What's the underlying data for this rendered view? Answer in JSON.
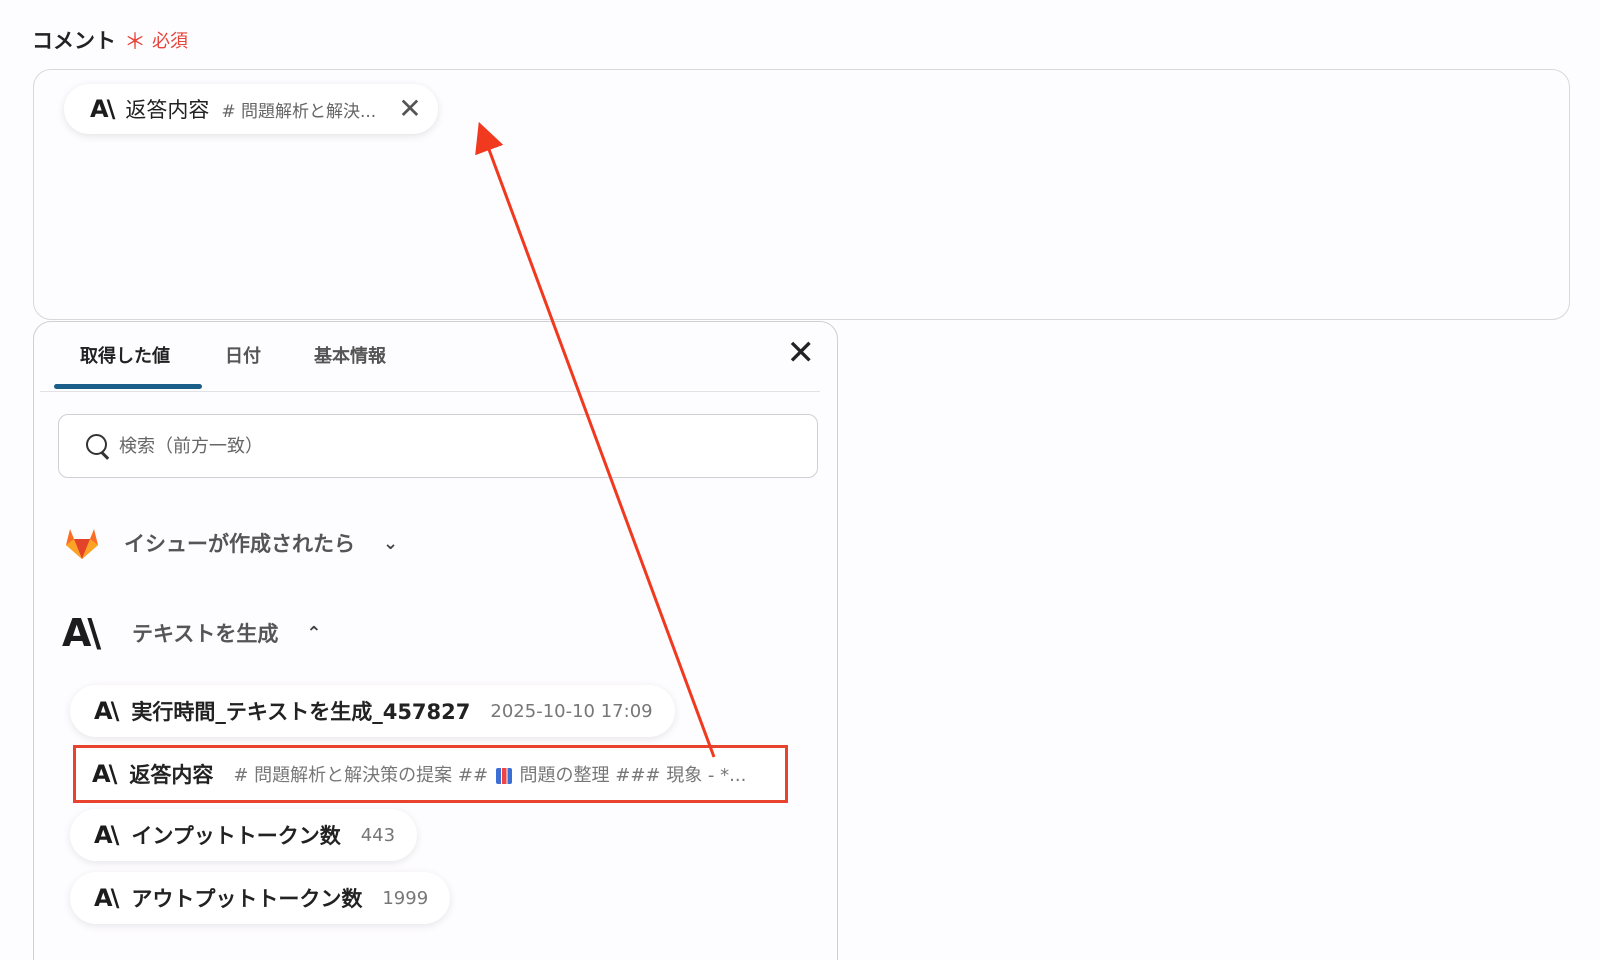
{
  "form": {
    "label": "コメント",
    "required_mark": "＊",
    "required_text": "必須"
  },
  "chip": {
    "logo": "A\\",
    "label": "返答内容",
    "preview": "# 問題解析と解決...",
    "close": "✕"
  },
  "panel": {
    "tabs": [
      "取得した値",
      "日付",
      "基本情報"
    ],
    "active_tab": "取得した値",
    "close": "✕",
    "search_placeholder": "検索（前方一致）",
    "groups": [
      {
        "title": "イシューが作成されたら",
        "icon": "gitlab-fox-icon",
        "expanded": false
      },
      {
        "title": "テキストを生成",
        "icon": "anthropic-logo-icon",
        "expanded": true
      }
    ],
    "items": [
      {
        "label": "実行時間_テキストを生成_457827",
        "value": "2025-10-10 17:09"
      },
      {
        "label": "返答内容",
        "value_prefix": "# 問題解析と解決策の提案 ##",
        "value_suffix": "問題の整理 ### 現象 - *...",
        "highlighted": true
      },
      {
        "label": "インプットトークン数",
        "value": "443"
      },
      {
        "label": "アウトプットトークン数",
        "value": "1999"
      }
    ],
    "logo": "A\\"
  },
  "colors": {
    "accent": "#1a5e8a",
    "highlight_border": "#e8432f",
    "required": "#e8443a",
    "arrow": "#f0391e"
  }
}
